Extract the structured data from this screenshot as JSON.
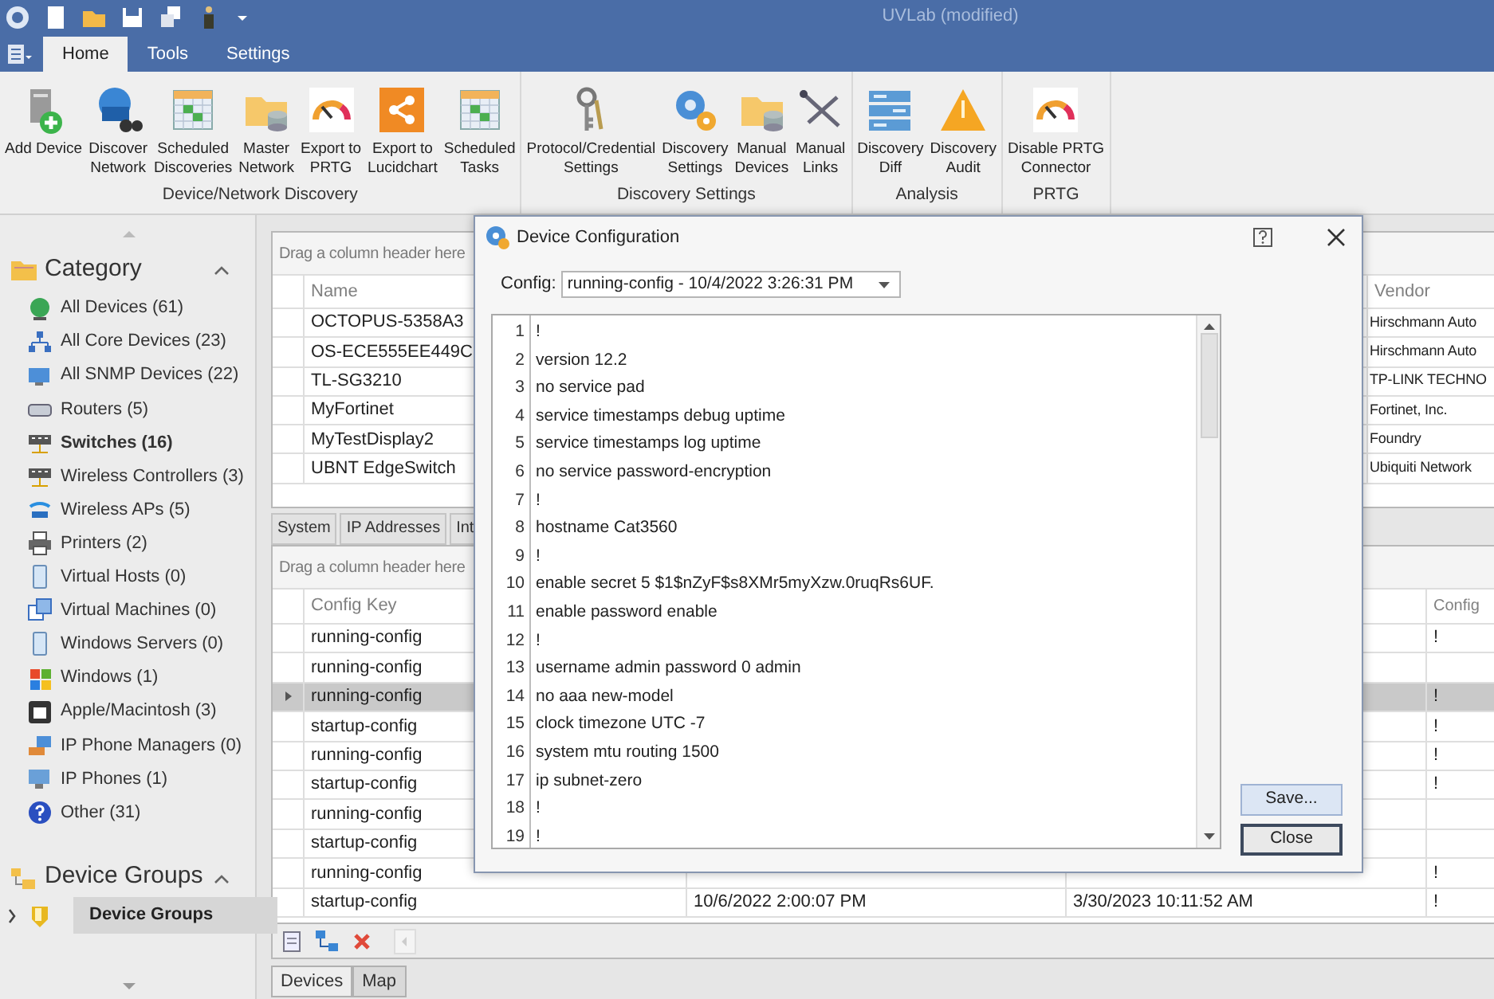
{
  "title_bar": {
    "title": "UVLab (modified)"
  },
  "ribbon": {
    "tabs": [
      {
        "label": "Home",
        "selected": true
      },
      {
        "label": "Tools",
        "selected": false
      },
      {
        "label": "Settings",
        "selected": false
      }
    ],
    "groups": [
      {
        "label": "Device/Network Discovery",
        "buttons": [
          "Add Device",
          "Discover\nNetwork",
          "Scheduled\nDiscoveries",
          "Master\nNetwork",
          "Export to\nPRTG",
          "Export to\nLucidchart",
          "Scheduled\nTasks"
        ]
      },
      {
        "label": "Discovery Settings",
        "buttons": [
          "Protocol/Credential\nSettings",
          "Discovery\nSettings",
          "Manual\nDevices",
          "Manual\nLinks"
        ]
      },
      {
        "label": "Analysis",
        "buttons": [
          "Discovery\nDiff",
          "Discovery\nAudit"
        ]
      },
      {
        "label": "PRTG",
        "buttons": [
          "Disable PRTG\nConnector"
        ]
      }
    ]
  },
  "sidebar": {
    "category": {
      "title": "Category",
      "expanded": true,
      "items": [
        {
          "label": "All Devices (61)",
          "selected": false
        },
        {
          "label": "All Core Devices (23)",
          "selected": false
        },
        {
          "label": "All SNMP Devices (22)",
          "selected": false
        },
        {
          "label": "Routers (5)",
          "selected": false
        },
        {
          "label": "Switches (16)",
          "selected": true
        },
        {
          "label": "Wireless Controllers (3)",
          "selected": false
        },
        {
          "label": "Wireless APs (5)",
          "selected": false
        },
        {
          "label": "Printers (2)",
          "selected": false
        },
        {
          "label": "Virtual Hosts (0)",
          "selected": false
        },
        {
          "label": "Virtual Machines (0)",
          "selected": false
        },
        {
          "label": "Windows Servers (0)",
          "selected": false
        },
        {
          "label": "Windows (1)",
          "selected": false
        },
        {
          "label": "Apple/Macintosh (3)",
          "selected": false
        },
        {
          "label": "IP Phone Managers (0)",
          "selected": false
        },
        {
          "label": "IP Phones (1)",
          "selected": false
        },
        {
          "label": "Other (31)",
          "selected": false
        }
      ]
    },
    "device_groups": {
      "title": "Device Groups",
      "expanded": true,
      "items": [
        {
          "label": "Device Groups",
          "selected": true,
          "expanded": false
        }
      ]
    }
  },
  "devices_grid": {
    "group_panel": "Drag a column header here",
    "columns": [
      "Name",
      "Vendor"
    ],
    "rows": [
      {
        "name": "OCTOPUS-5358A3",
        "vendor": "Hirschmann Auto"
      },
      {
        "name": "OS-ECE555EE449C",
        "vendor": "Hirschmann Auto"
      },
      {
        "name": "TL-SG3210",
        "vendor": "TP-LINK TECHNO"
      },
      {
        "name": "MyFortinet",
        "vendor": "Fortinet, Inc."
      },
      {
        "name": "MyTestDisplay2",
        "vendor": "Foundry"
      },
      {
        "name": "UBNT EdgeSwitch",
        "vendor": "Ubiquiti Network"
      }
    ]
  },
  "detail_tabs": [
    {
      "label": "System"
    },
    {
      "label": "IP Addresses"
    },
    {
      "label": "Int"
    }
  ],
  "config_grid": {
    "group_panel": "Drag a column header here",
    "columns": [
      "Config Key",
      "Config"
    ],
    "rows": [
      {
        "config_key": "running-config",
        "config": "!",
        "selected": false
      },
      {
        "config_key": "running-config",
        "selected": false
      },
      {
        "config_key": "running-config",
        "config": "!",
        "selected": true
      },
      {
        "config_key": "startup-config",
        "config": "!",
        "selected": false
      },
      {
        "config_key": "running-config",
        "config": "!",
        "selected": false
      },
      {
        "config_key": "startup-config",
        "config": "!",
        "selected": false
      },
      {
        "config_key": "running-config",
        "selected": false
      },
      {
        "config_key": "startup-config",
        "selected": false
      },
      {
        "config_key": "running-config",
        "config": "!",
        "selected": false
      },
      {
        "config_key": "startup-config",
        "column_2": "10/6/2022 2:00:07 PM",
        "column_3": "3/30/2023 10:11:52 AM",
        "config": "!",
        "selected": false
      }
    ]
  },
  "bottom_tabs": [
    {
      "label": "Devices",
      "selected": true
    },
    {
      "label": "Map",
      "selected": false
    }
  ],
  "dialog": {
    "title": "Device Configuration",
    "config_label": "Config:",
    "config_value": "running-config - 10/4/2022 3:26:31 PM",
    "lines": [
      {
        "n": "1",
        "text": "!"
      },
      {
        "n": "2",
        "text": "version 12.2"
      },
      {
        "n": "3",
        "text": "no service pad"
      },
      {
        "n": "4",
        "text": "service timestamps debug uptime"
      },
      {
        "n": "5",
        "text": "service timestamps log uptime"
      },
      {
        "n": "6",
        "text": "no service password-encryption"
      },
      {
        "n": "7",
        "text": "!"
      },
      {
        "n": "8",
        "text": "hostname Cat3560"
      },
      {
        "n": "9",
        "text": "!"
      },
      {
        "n": "10",
        "text": "enable secret 5 $1$nZyF$s8XMr5myXzw.0ruqRs6UF."
      },
      {
        "n": "11",
        "text": "enable password enable"
      },
      {
        "n": "12",
        "text": "!"
      },
      {
        "n": "13",
        "text": "username admin password 0 admin"
      },
      {
        "n": "14",
        "text": "no aaa new-model"
      },
      {
        "n": "15",
        "text": "clock timezone UTC -7"
      },
      {
        "n": "16",
        "text": "system mtu routing 1500"
      },
      {
        "n": "17",
        "text": "ip subnet-zero"
      },
      {
        "n": "18",
        "text": "!"
      },
      {
        "n": "19",
        "text": "!"
      }
    ],
    "buttons": [
      {
        "label": "Save...",
        "hovered": true,
        "default": false
      },
      {
        "label": "Close",
        "hovered": false,
        "default": true
      }
    ]
  }
}
